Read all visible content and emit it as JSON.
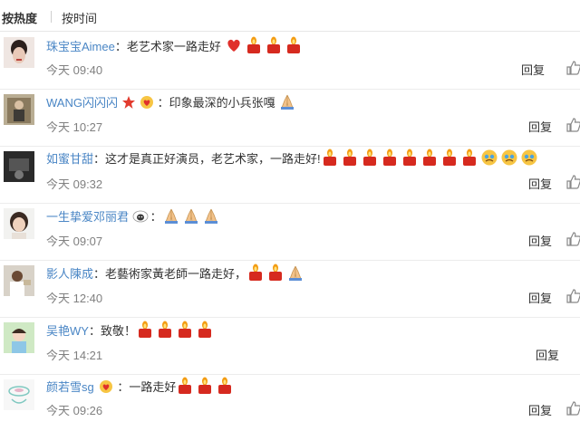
{
  "sort": {
    "hot": "按热度",
    "time": "按时间"
  },
  "separator": "：",
  "reply_label": "回复",
  "colors": {
    "username": "#4a86c5",
    "time": "#808080",
    "candle_flame": "#f39c12",
    "candle_body": "#d62a1f",
    "heart": "#e0302b"
  },
  "comments": [
    {
      "user": "珠宝宝Aimee",
      "text": "老艺术家一路走好",
      "emojis": [
        "heart-emoji",
        "candle-emoji",
        "candle-emoji",
        "candle-emoji"
      ],
      "time": "今天 09:40"
    },
    {
      "user": "WANG闪闪闪",
      "text": "印象最深的小兵张嘎",
      "emojis": [
        "praying-hands-emoji"
      ],
      "badges": [
        "red-star-icon",
        "heart-hands-emoji"
      ],
      "time": "今天 10:27"
    },
    {
      "user": "如蜜甘甜",
      "text": "这才是真正好演员，老艺术家，一路走好!",
      "emojis": [
        "candle-emoji",
        "candle-emoji",
        "candle-emoji",
        "candle-emoji",
        "candle-emoji",
        "candle-emoji",
        "candle-emoji",
        "candle-emoji",
        "crying-face-emoji",
        "crying-face-emoji",
        "crying-face-emoji"
      ],
      "time": "今天 09:32"
    },
    {
      "user": "一生挚爱邓丽君",
      "text": "",
      "emojis": [
        "praying-hands-emoji",
        "praying-hands-emoji",
        "praying-hands-emoji"
      ],
      "badges": [
        "sheep-icon"
      ],
      "time": "今天 09:07"
    },
    {
      "user": "影人陳成",
      "text": "老藝術家黃老師一路走好，",
      "emojis": [
        "candle-emoji",
        "candle-emoji",
        "praying-hands-emoji"
      ],
      "time": "今天 12:40"
    },
    {
      "user": "吴艳WY",
      "text": "致敬！",
      "emojis": [
        "candle-emoji",
        "candle-emoji",
        "candle-emoji",
        "candle-emoji"
      ],
      "time": "今天 14:21"
    },
    {
      "user": "颜若雪sg",
      "text": "一路走好",
      "emojis": [
        "candle-emoji",
        "candle-emoji",
        "candle-emoji"
      ],
      "badges": [
        "heart-hands-emoji"
      ],
      "time": "今天 09:26"
    }
  ]
}
